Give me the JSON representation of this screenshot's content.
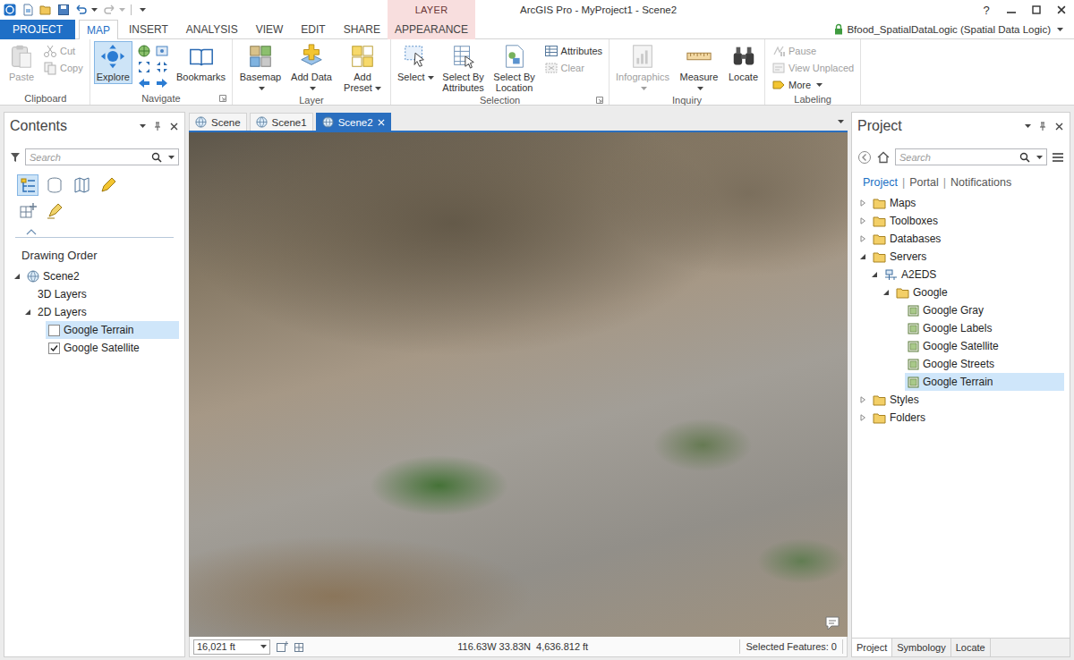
{
  "window": {
    "title": "ArcGIS Pro - MyProject1 - Scene2",
    "contextual_group": "LAYER",
    "help": "?",
    "user": "Bfood_SpatialDataLogic (Spatial Data Logic)"
  },
  "ribbon_tabs": [
    {
      "label": "PROJECT",
      "selected": false,
      "kind": "backstage"
    },
    {
      "label": "MAP",
      "selected": true,
      "kind": "core"
    },
    {
      "label": "INSERT",
      "selected": false,
      "kind": "core"
    },
    {
      "label": "ANALYSIS",
      "selected": false,
      "kind": "core"
    },
    {
      "label": "VIEW",
      "selected": false,
      "kind": "core"
    },
    {
      "label": "EDIT",
      "selected": false,
      "kind": "core"
    },
    {
      "label": "SHARE",
      "selected": false,
      "kind": "core"
    },
    {
      "label": "APPEARANCE",
      "selected": false,
      "kind": "contextual"
    }
  ],
  "ribbon_groups": [
    {
      "label": "Clipboard",
      "launcher": false,
      "buttons": [
        {
          "kind": "large",
          "label": "Paste",
          "disabled": true,
          "selected": false,
          "caret": false
        },
        {
          "kind": "stack",
          "items": [
            {
              "label": "Cut",
              "disabled": true,
              "caret": false
            },
            {
              "label": "Copy",
              "disabled": true,
              "caret": false
            }
          ]
        }
      ]
    },
    {
      "label": "Navigate",
      "launcher": true,
      "buttons": [
        {
          "kind": "large",
          "label": "Explore",
          "disabled": false,
          "selected": true,
          "caret": false
        },
        {
          "kind": "toolgrid",
          "disabled": false
        },
        {
          "kind": "large",
          "label": "Bookmarks",
          "disabled": false,
          "selected": false,
          "caret": false
        }
      ]
    },
    {
      "label": "Layer",
      "launcher": false,
      "buttons": [
        {
          "kind": "large",
          "label": "Basemap",
          "disabled": false,
          "selected": false,
          "caret": true
        },
        {
          "kind": "large",
          "label": "Add Data",
          "disabled": false,
          "selected": false,
          "caret": true
        },
        {
          "kind": "large",
          "label": "Add Preset",
          "disabled": false,
          "selected": false,
          "caret": true
        }
      ]
    },
    {
      "label": "Selection",
      "launcher": true,
      "buttons": [
        {
          "kind": "large",
          "label": "Select",
          "disabled": false,
          "selected": false,
          "caret": true
        },
        {
          "kind": "large",
          "label": "Select By Attributes",
          "disabled": false,
          "selected": false,
          "caret": false
        },
        {
          "kind": "large",
          "label": "Select By Location",
          "disabled": false,
          "selected": false,
          "caret": false
        },
        {
          "kind": "stack",
          "items": [
            {
              "label": "Attributes",
              "disabled": false,
              "caret": false
            },
            {
              "label": "Clear",
              "disabled": true,
              "caret": false
            }
          ]
        }
      ]
    },
    {
      "label": "Inquiry",
      "launcher": false,
      "buttons": [
        {
          "kind": "large",
          "label": "Infographics",
          "disabled": true,
          "selected": false,
          "caret": true
        },
        {
          "kind": "large",
          "label": "Measure",
          "disabled": false,
          "selected": false,
          "caret": true
        },
        {
          "kind": "large",
          "label": "Locate",
          "disabled": false,
          "selected": false,
          "caret": false
        }
      ]
    },
    {
      "label": "Labeling",
      "launcher": false,
      "buttons": [
        {
          "kind": "stack",
          "items": [
            {
              "label": "Pause",
              "disabled": true,
              "caret": false
            },
            {
              "label": "View Unplaced",
              "disabled": true,
              "caret": false
            },
            {
              "label": "More",
              "disabled": false,
              "caret": true
            }
          ]
        }
      ]
    }
  ],
  "contents": {
    "title": "Contents",
    "search": {
      "placeholder": "Search"
    },
    "views": [
      {
        "selected": true
      },
      {
        "selected": false
      },
      {
        "selected": false
      },
      {
        "selected": false
      },
      {
        "selected": false
      },
      {
        "selected": false
      }
    ],
    "heading": "Drawing Order",
    "tree": [
      {
        "label": "Scene2",
        "kind": "scene",
        "expanded": true,
        "selected": false,
        "children": [
          {
            "label": "3D Layers",
            "kind": "group",
            "selected": false,
            "children": []
          },
          {
            "label": "2D Layers",
            "kind": "group",
            "expanded": true,
            "selected": false,
            "children": [
              {
                "label": "Google Terrain",
                "kind": "layer",
                "checked": false,
                "selected": true,
                "children": []
              },
              {
                "label": "Google Satellite",
                "kind": "layer",
                "checked": true,
                "selected": false,
                "children": []
              }
            ]
          }
        ]
      }
    ]
  },
  "view": {
    "tabs": [
      {
        "label": "Scene",
        "selected": false,
        "closable": false
      },
      {
        "label": "Scene1",
        "selected": false,
        "closable": false
      },
      {
        "label": "Scene2",
        "selected": true,
        "closable": true
      }
    ],
    "status_bar": {
      "scale": "16,021 ft",
      "coordinates": "116.63W 33.83N",
      "elevation": "4,636.812 ft",
      "selection": "Selected Features: 0"
    }
  },
  "project": {
    "title": "Project",
    "search": {
      "placeholder": "Search"
    },
    "nav": [
      {
        "label": "Project",
        "selected": true
      },
      {
        "label": "Portal",
        "selected": false
      },
      {
        "label": "Notifications",
        "selected": false
      }
    ],
    "separator": "|",
    "tree": [
      {
        "label": "Maps",
        "kind": "folder",
        "expanded": false,
        "selected": false,
        "children": []
      },
      {
        "label": "Toolboxes",
        "kind": "folder",
        "expanded": false,
        "selected": false,
        "children": []
      },
      {
        "label": "Databases",
        "kind": "folder",
        "expanded": false,
        "selected": false,
        "children": []
      },
      {
        "label": "Servers",
        "kind": "folder",
        "expanded": true,
        "selected": false,
        "children": [
          {
            "label": "A2EDS",
            "kind": "server",
            "expanded": true,
            "selected": false,
            "children": [
              {
                "label": "Google",
                "kind": "folder",
                "expanded": true,
                "selected": false,
                "children": [
                  {
                    "label": "Google Gray",
                    "kind": "service",
                    "selected": false,
                    "children": []
                  },
                  {
                    "label": "Google Labels",
                    "kind": "service",
                    "selected": false,
                    "children": []
                  },
                  {
                    "label": "Google Satellite",
                    "kind": "service",
                    "selected": false,
                    "children": []
                  },
                  {
                    "label": "Google Streets",
                    "kind": "service",
                    "selected": false,
                    "children": []
                  },
                  {
                    "label": "Google Terrain",
                    "kind": "service",
                    "selected": true,
                    "children": []
                  }
                ]
              }
            ]
          }
        ]
      },
      {
        "label": "Styles",
        "kind": "folder",
        "expanded": false,
        "selected": false,
        "children": []
      },
      {
        "label": "Folders",
        "kind": "folder",
        "expanded": false,
        "selected": false,
        "children": []
      }
    ],
    "bottom_tabs": [
      {
        "label": "Project",
        "selected": true
      },
      {
        "label": "Symbology",
        "selected": false
      },
      {
        "label": "Locate",
        "selected": false
      }
    ]
  }
}
